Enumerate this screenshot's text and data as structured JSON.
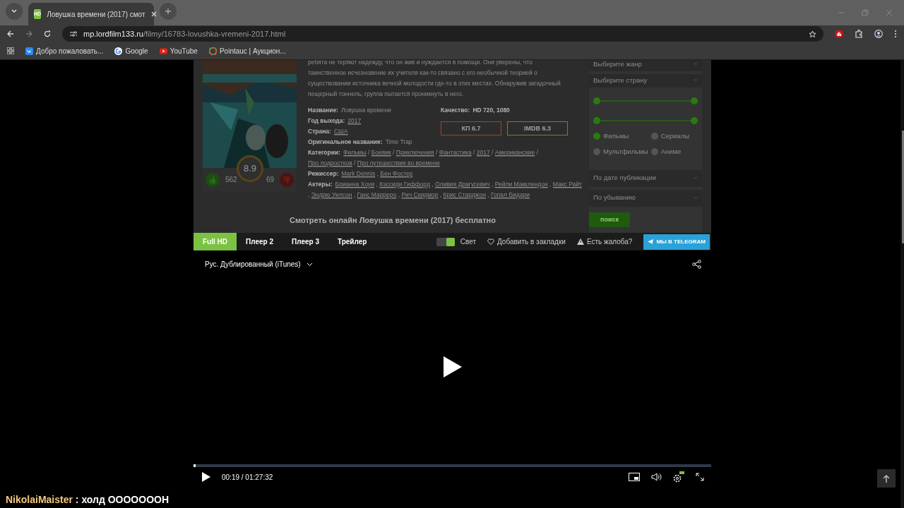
{
  "browser": {
    "tab": {
      "title": "Ловушка времени (2017) смот",
      "favicon": "HD"
    },
    "address": {
      "host": "mp.lordfilm133.ru",
      "path": "/filmy/16783-lovushka-vremeni-2017.html"
    },
    "bookmarks": [
      {
        "label": "Добро пожаловать..."
      },
      {
        "label": "Google"
      },
      {
        "label": "YouTube"
      },
      {
        "label": "Pointauc | Аукцион..."
      }
    ]
  },
  "film": {
    "rating": "8.9",
    "likes": "562",
    "dislikes": "69",
    "description": [
      "ребята не теряют надежду, что он жив и нуждается в помощи. Они уверены, что",
      "таинственное исчезновение их учителя как-то связано с его необычной теорией о",
      "существовании источника вечной молодости где-то в этих местах. Обнаружив",
      "загадочный пещерный тоннель, группа пытается проникнуть в него."
    ],
    "quality": {
      "label": "Качество:",
      "value": "HD 720, 1080"
    },
    "scores": [
      {
        "label": "КП 6.7",
        "color": "#a0461f"
      },
      {
        "label": "IMDB 6.3",
        "color": "#8a7a20"
      }
    ],
    "info": [
      {
        "label": "Название:",
        "kind": "text",
        "values": [
          "Ловушка времени"
        ]
      },
      {
        "label": "Год выхода:",
        "kind": "links",
        "values": [
          "2017"
        ]
      },
      {
        "label": "Страна:",
        "kind": "links",
        "values": [
          "США"
        ]
      },
      {
        "label": "Оригинальное название:",
        "kind": "text",
        "values": [
          "Time Trap"
        ]
      },
      {
        "label": "Категории:",
        "kind": "links",
        "separator": " / ",
        "values": [
          "Фильмы",
          "Боевик",
          "Приключения",
          "Фантастика",
          "2017",
          "Американские",
          "Про подростков",
          "Про путешествия во времени"
        ]
      },
      {
        "label": "Режиссер:",
        "kind": "links",
        "separator": ", ",
        "values": [
          "Mark Dennis",
          "Бен Фостер"
        ]
      },
      {
        "label": "Актеры:",
        "kind": "links",
        "separator": ", ",
        "values": [
          "Брианна Хоуи",
          "Кэссиди Гиффорд",
          "Оливия Драгусевич",
          "Рейли Макклендон",
          "Макс Райт",
          "Эндрю Уилсон",
          "Ганс Марреро",
          "Рич Скидмор",
          "Крис Старджон",
          "Гопал Бидари"
        ]
      }
    ],
    "watch_title": "Смотреть онлайн Ловушка времени (2017) бесплатно"
  },
  "filter": {
    "selects_top": [
      "Выберите жанр",
      "Выберите страну"
    ],
    "ranges": [
      {
        "level": 1
      },
      {
        "level": 1
      }
    ],
    "types": [
      {
        "label": "Фильмы",
        "checked": true
      },
      {
        "label": "Сериалы",
        "checked": false
      },
      {
        "label": "Мультфильмы",
        "checked": false
      },
      {
        "label": "Аниме",
        "checked": false
      }
    ],
    "selects_bottom": [
      "По дате публикации",
      "По убыванию"
    ],
    "button": "поиск"
  },
  "player_tabs": [
    {
      "label": "Full HD",
      "selected": true
    },
    {
      "label": "Плеер 2",
      "selected": false
    },
    {
      "label": "Плеер 3",
      "selected": false
    },
    {
      "label": "Трейлер",
      "selected": false
    }
  ],
  "light_toggle": {
    "label": "Свет",
    "on": true
  },
  "bookmark_link": "Добавить в закладки",
  "complaint_link": "Есть жалоба?",
  "telegram_button": "МЫ В TELEGRAM",
  "player": {
    "audio_track": "Рус. Дублированный (iTunes)",
    "progress": {
      "level": 0.004
    },
    "time": "00:19 / 01:27:32"
  },
  "chat": {
    "user": "NikolaiMaister",
    "message": " : холд ООООООOН"
  }
}
